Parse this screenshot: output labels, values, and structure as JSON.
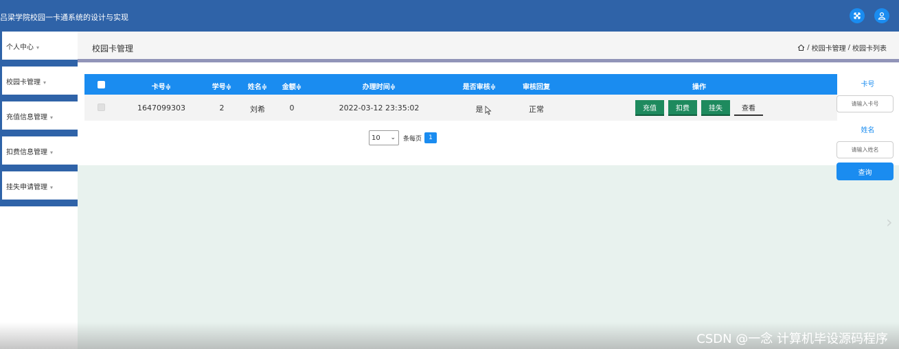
{
  "app": {
    "title": "吕梁学院校园一卡通系统的设计与实现"
  },
  "top_icons": [
    "fullscreen-icon",
    "user-icon"
  ],
  "sidebar": {
    "items": [
      {
        "label": "个人中心"
      },
      {
        "label": "校园卡管理"
      },
      {
        "label": "充值信息管理"
      },
      {
        "label": "扣费信息管理"
      },
      {
        "label": "挂失申请管理"
      }
    ]
  },
  "page": {
    "title": "校园卡管理",
    "breadcrumb": [
      "校园卡管理",
      "校园卡列表"
    ],
    "breadcrumb_sep": "/"
  },
  "table": {
    "columns": [
      "卡号",
      "学号",
      "姓名",
      "金额",
      "办理时间",
      "是否审核",
      "审核回复",
      "操作"
    ],
    "sort_glyph": "≑",
    "rows": [
      {
        "card_no": "1647099303",
        "student_no": "2",
        "name": "刘希",
        "amount": "0",
        "time": "2022-03-12 23:35:02",
        "reviewed": "是",
        "reply": "正常",
        "actions": [
          "充值",
          "扣费",
          "挂失",
          "查看"
        ]
      }
    ]
  },
  "pagination": {
    "page_size": "10",
    "per_page_label": "条每页",
    "current_page": "1"
  },
  "search": {
    "card_label": "卡号",
    "card_placeholder": "请输入卡号",
    "name_label": "姓名",
    "name_placeholder": "请输入姓名",
    "button": "查询"
  },
  "watermark": "CSDN @一念 计算机毕设源码程序",
  "colors": {
    "header": "#2f63a8",
    "accent": "#1a8cf0",
    "action_green": "#1e8a5e",
    "content_bg": "#e8f2ee"
  }
}
